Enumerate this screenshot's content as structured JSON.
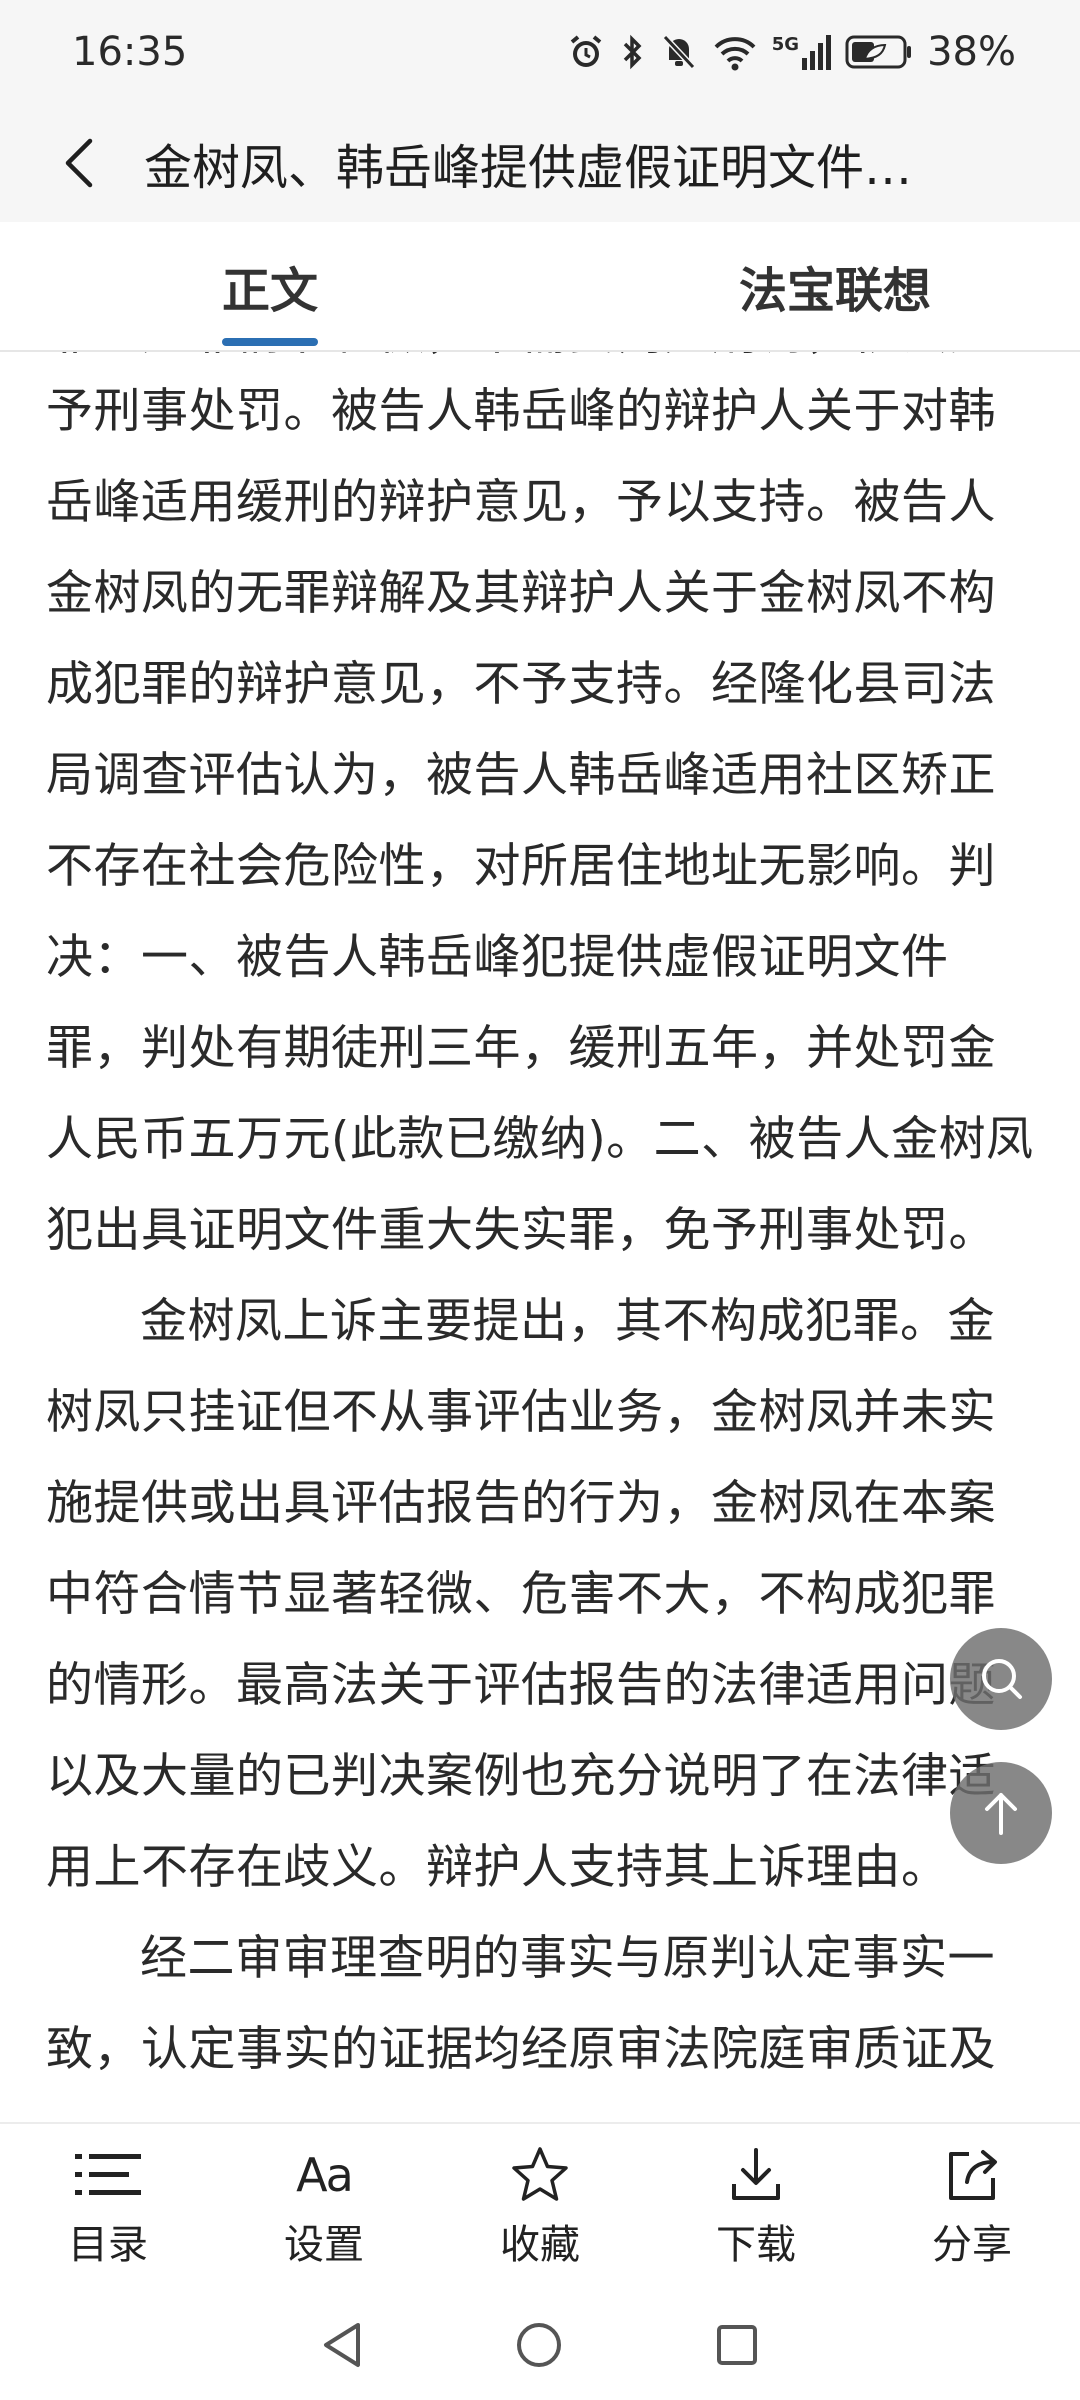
{
  "status_bar": {
    "time": "16:35",
    "network": "5G",
    "battery": "38%"
  },
  "topnav": {
    "title": "金树凤、韩岳峰提供虚假证明文件…"
  },
  "tabs": [
    {
      "label": "正文",
      "active": true
    },
    {
      "label": "法宝联想",
      "active": false
    }
  ],
  "content": {
    "partial_top_line": "非且无非情节轻微，不需要判处刑罚，依法免",
    "paragraphs": [
      "予刑事处罚。被告人韩岳峰的辩护人关于对韩岳峰适用缓刑的辩护意见，予以支持。被告人金树凤的无罪辩解及其辩护人关于金树凤不构成犯罪的辩护意见，不予支持。经隆化县司法局调查评估认为，被告人韩岳峰适用社区矫正不存在社会危险性，对所居住地址无影响。判决：一、被告人韩岳峰犯提供虚假证明文件罪，判处有期徒刑三年，缓刑五年，并处罚金人民币五万元(此款已缴纳)。二、被告人金树凤犯出具证明文件重大失实罪，免予刑事处罚。",
      "金树凤上诉主要提出，其不构成犯罪。金树凤只挂证但不从事评估业务，金树凤并未实施提供或出具评估报告的行为，金树凤在本案中符合情节显著轻微、危害不大，不构成犯罪的情形。最高法关于评估报告的法律适用问题以及大量的已判决案例也充分说明了在法律适用上不存在歧义。辩护人支持其上诉理由。",
      "经二审审理查明的事实与原判认定事实一致，认定事实的证据均经原审法院庭审质证及"
    ]
  },
  "toolbar": {
    "items": [
      {
        "label": "目录",
        "icon": "list-icon"
      },
      {
        "label": "设置",
        "icon": "font-settings-icon",
        "glyph": "Aa"
      },
      {
        "label": "收藏",
        "icon": "star-icon"
      },
      {
        "label": "下载",
        "icon": "download-icon"
      },
      {
        "label": "分享",
        "icon": "share-icon"
      }
    ]
  },
  "colors": {
    "accent": "#2b6fb3",
    "header_bg": "#f6f6f6",
    "fab_bg": "#6e6e6e"
  }
}
